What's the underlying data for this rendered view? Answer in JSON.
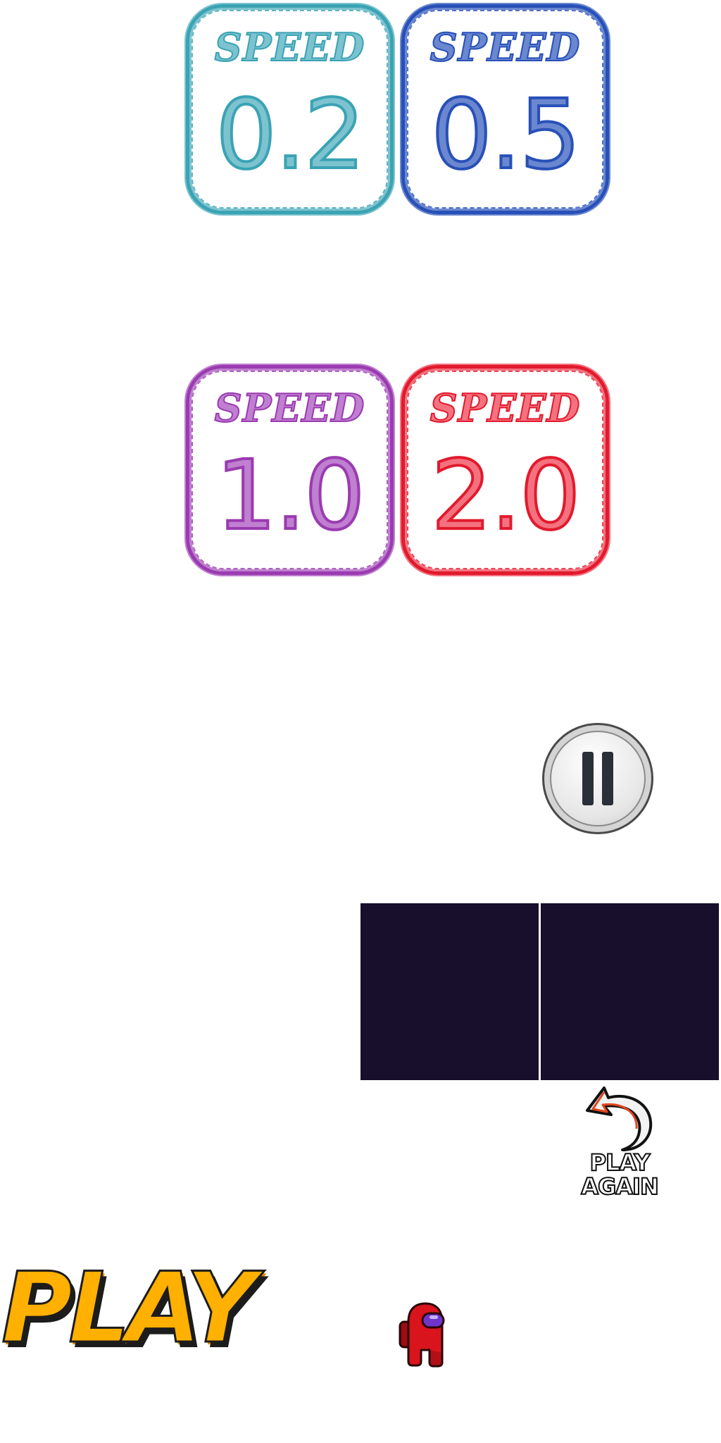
{
  "speed_buttons": [
    {
      "word": "SPEED",
      "value": "0.2"
    },
    {
      "word": "SPEED",
      "value": "0.5"
    },
    {
      "word": "SPEED",
      "value": "1.0"
    },
    {
      "word": "SPEED",
      "value": "2.0"
    }
  ],
  "play_again": {
    "line1": "PLAY",
    "line2": "AGAIN"
  },
  "play": {
    "label": "PLAY"
  },
  "colors": {
    "speed_0_2": "#3aa3b4",
    "speed_0_5": "#2850b8",
    "speed_1_0": "#9a3bb0",
    "speed_2_0": "#e21a2d",
    "panel_dark": "#170f2b",
    "play_orange": "#ffb000",
    "crewmate_red": "#d9141c"
  },
  "icons": {
    "pause": "pause-icon",
    "replay_arrow": "replay-arrow-icon",
    "crewmate": "crewmate-icon"
  }
}
